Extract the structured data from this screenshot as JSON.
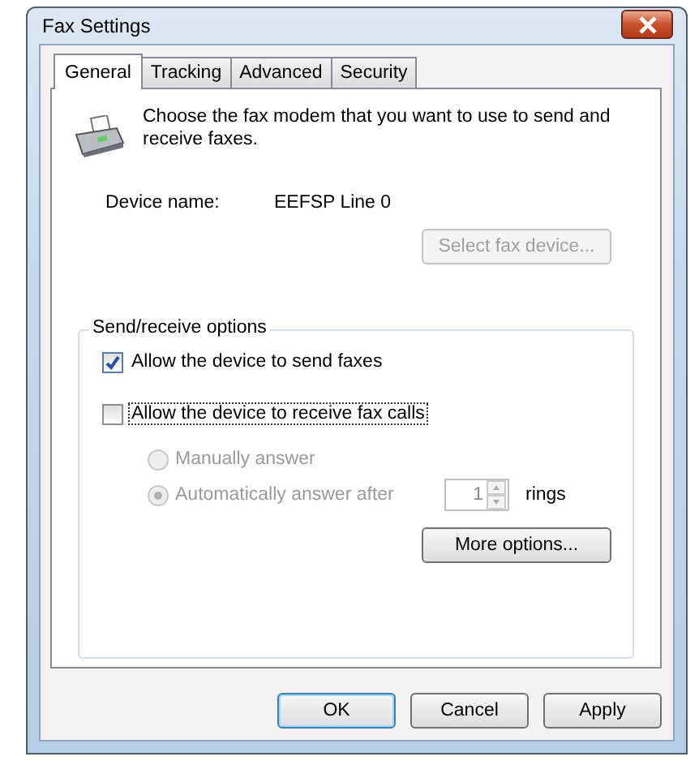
{
  "window": {
    "title": "Fax Settings"
  },
  "tabs": [
    {
      "label": "General",
      "selected": true
    },
    {
      "label": "Tracking",
      "selected": false
    },
    {
      "label": "Advanced",
      "selected": false
    },
    {
      "label": "Security",
      "selected": false
    }
  ],
  "description": "Choose the fax modem that you want to use to send and receive faxes.",
  "device": {
    "label": "Device name:",
    "value": "EEFSP Line 0"
  },
  "select_button": {
    "label": "Select fax device...",
    "disabled": true
  },
  "group": {
    "title": "Send/receive options",
    "checkboxes": [
      {
        "label": "Allow the device to send faxes",
        "checked": true,
        "focused": false
      },
      {
        "label": "Allow the device to receive fax calls",
        "checked": false,
        "focused": true
      }
    ],
    "radios": [
      {
        "label": "Manually answer",
        "selected": false,
        "disabled": true
      },
      {
        "label": "Automatically answer after",
        "selected": true,
        "disabled": true
      }
    ],
    "rings": {
      "value": "1",
      "suffix": "rings",
      "disabled": true
    },
    "more_button": {
      "label": "More options...",
      "disabled": false
    }
  },
  "buttons": [
    {
      "label": "OK",
      "default": true
    },
    {
      "label": "Cancel",
      "default": false
    },
    {
      "label": "Apply",
      "default": false
    }
  ]
}
